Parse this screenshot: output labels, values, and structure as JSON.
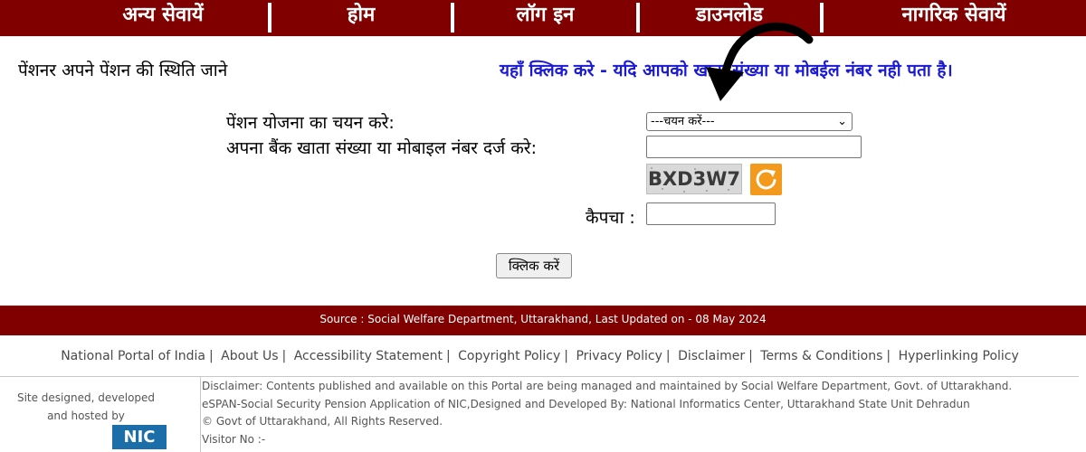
{
  "nav": {
    "items": [
      "अन्य सेवायें",
      "होम",
      "लॉग इन",
      "डाउनलोड",
      "नागरिक सेवायें"
    ]
  },
  "header": {
    "title": "पेंशनर अपने पेंशन की स्थिति जाने",
    "help_link": "यहाँ क्लिक करे - यदि आपको खाता संख्या या मोबईल नंबर नही पता है।"
  },
  "form": {
    "scheme_label": "पेंशन योजना का चयन करे:",
    "scheme_selected": "---चयन करें---",
    "account_label": "अपना बैंक खाता संख्या या मोबाइल नंबर दर्ज करे:",
    "account_value": "",
    "captcha_image_text": "BXD3W7",
    "captcha_label": "कैपचा :",
    "captcha_value": "",
    "submit_label": "क्लिक करें"
  },
  "source_bar": {
    "text": "Source : Social Welfare Department, Uttarakhand, Last Updated on - 08 May 2024"
  },
  "footer": {
    "links": [
      "National Portal of India",
      "About Us",
      "Accessibility Statement",
      "Copyright Policy",
      "Privacy Policy",
      "Disclaimer",
      "Terms & Conditions",
      "Hyperlinking Policy"
    ],
    "separator": "|",
    "credit_line1": "Site designed, developed",
    "credit_line2": "and hosted by",
    "nic_logo": "NIC",
    "disclaimer_lines": [
      "Disclaimer: Contents published and available on this Portal are being managed and maintained by Social Welfare Department, Govt. of Uttarakhand.",
      "eSPAN-Social Security Pension Application of NIC,Designed and Developed By: National Informatics Center, Uttarakhand State Unit Dehradun",
      "© Govt of Uttarakhand, All Rights Reserved.",
      "Visitor No :-"
    ]
  },
  "colors": {
    "nav_bg": "#800000",
    "link_blue": "#1a1ad6",
    "refresh_orange": "#f39a1d"
  },
  "icons": {
    "refresh": "refresh-icon",
    "dropdown": "chevron-down-icon",
    "arrow": "curved-arrow-icon"
  }
}
